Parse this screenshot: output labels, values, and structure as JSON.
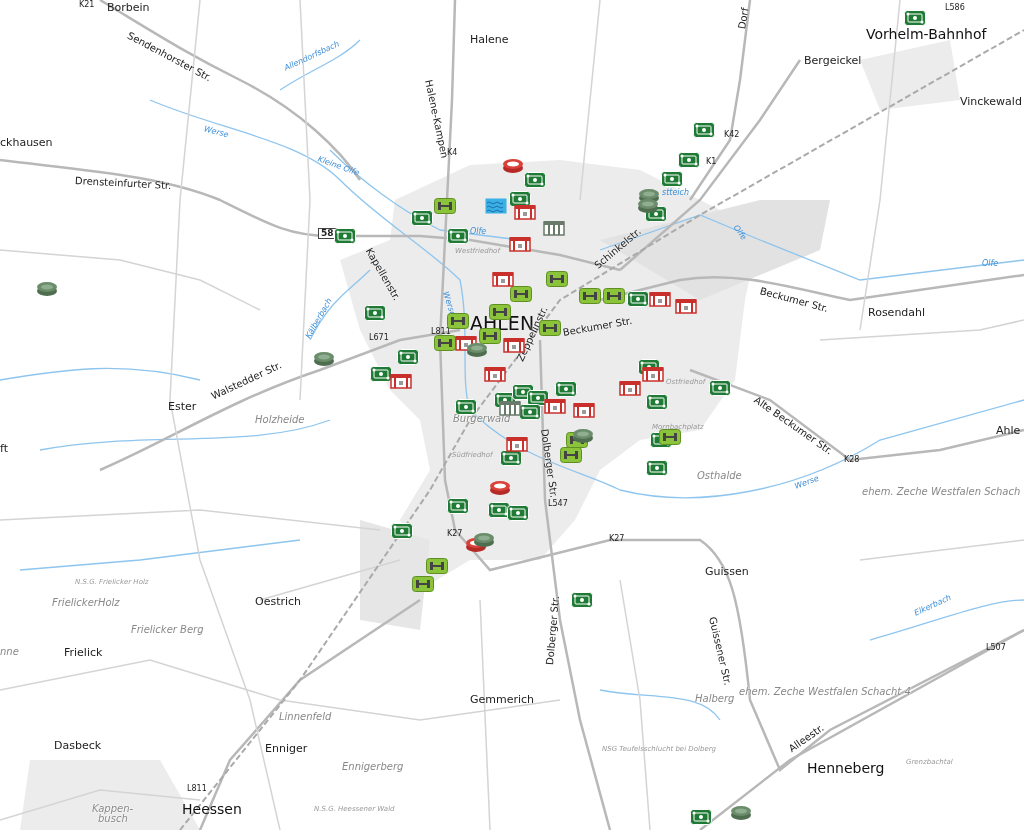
{
  "map": {
    "labels": [
      {
        "text": "K21",
        "kind": "road"
      },
      {
        "text": "Borbein",
        "kind": "place"
      },
      {
        "text": "Sendenhorster Str.",
        "kind": "street"
      },
      {
        "text": "Halene",
        "kind": "place"
      },
      {
        "text": "Halene-Kampen",
        "kind": "street"
      },
      {
        "text": "Dorf",
        "kind": "street"
      },
      {
        "text": "L586",
        "kind": "road"
      },
      {
        "text": "Vorhelm-Bahnhof",
        "kind": "town"
      },
      {
        "text": "Bergeickel",
        "kind": "place"
      },
      {
        "text": "Allendorfsbach",
        "kind": "water"
      },
      {
        "text": "Vinckewald",
        "kind": "place"
      },
      {
        "text": "Werse",
        "kind": "water"
      },
      {
        "text": "ckhausen",
        "kind": "place"
      },
      {
        "text": "K42",
        "kind": "road"
      },
      {
        "text": "Kleine Olfe",
        "kind": "water"
      },
      {
        "text": "K4",
        "kind": "road"
      },
      {
        "text": "K1",
        "kind": "road"
      },
      {
        "text": "Drensteinfurter Str.",
        "kind": "street"
      },
      {
        "text": "stteich",
        "kind": "water"
      },
      {
        "text": "Olfe",
        "kind": "water"
      },
      {
        "text": "58",
        "kind": "shield"
      },
      {
        "text": "Kapellenstr.",
        "kind": "street"
      },
      {
        "text": "Schinkelstr.",
        "kind": "street"
      },
      {
        "text": "Westfriedhof",
        "kind": "small"
      },
      {
        "text": "Olfe",
        "kind": "water"
      },
      {
        "text": "Olfe",
        "kind": "water"
      },
      {
        "text": "Beckumer Str.",
        "kind": "street"
      },
      {
        "text": "Werse",
        "kind": "water"
      },
      {
        "text": "Rosendahl",
        "kind": "place"
      },
      {
        "text": "AHLEN",
        "kind": "city"
      },
      {
        "text": "Beckumer Str.",
        "kind": "street"
      },
      {
        "text": "L811",
        "kind": "road"
      },
      {
        "text": "L671",
        "kind": "road"
      },
      {
        "text": "Kälberbach",
        "kind": "water"
      },
      {
        "text": "Zeppelinstr.",
        "kind": "street"
      },
      {
        "text": "Ostfriedhof",
        "kind": "small"
      },
      {
        "text": "Alte Beckumer Str.",
        "kind": "street"
      },
      {
        "text": "Walstedder Str.",
        "kind": "street"
      },
      {
        "text": "Ester",
        "kind": "place"
      },
      {
        "text": "Holzheide",
        "kind": "area"
      },
      {
        "text": "Burgerwald",
        "kind": "area"
      },
      {
        "text": "Dolberger Str.",
        "kind": "street"
      },
      {
        "text": "Mornbachplatz",
        "kind": "small"
      },
      {
        "text": "Ahle",
        "kind": "place"
      },
      {
        "text": "ft",
        "kind": "place"
      },
      {
        "text": "Südfriedhof",
        "kind": "small"
      },
      {
        "text": "K28",
        "kind": "road"
      },
      {
        "text": "Osthalde",
        "kind": "area"
      },
      {
        "text": "Werse",
        "kind": "water"
      },
      {
        "text": "ehem. Zeche Westfalen Schach",
        "kind": "area"
      },
      {
        "text": "L547",
        "kind": "road"
      },
      {
        "text": "K27",
        "kind": "road"
      },
      {
        "text": "K27",
        "kind": "road"
      },
      {
        "text": "Guissen",
        "kind": "place"
      },
      {
        "text": "N.S.G. Frielicker Holz",
        "kind": "small"
      },
      {
        "text": "Oestrich",
        "kind": "place"
      },
      {
        "text": "FrielickerHolz",
        "kind": "area"
      },
      {
        "text": "Elkerbach",
        "kind": "water"
      },
      {
        "text": "Guissener Str.",
        "kind": "street"
      },
      {
        "text": "Frielicker Berg",
        "kind": "area"
      },
      {
        "text": "L507",
        "kind": "road"
      },
      {
        "text": "nne",
        "kind": "area"
      },
      {
        "text": "Frielick",
        "kind": "place"
      },
      {
        "text": "Dolberger Str.",
        "kind": "street"
      },
      {
        "text": "Halberg",
        "kind": "area"
      },
      {
        "text": "ehem. Zeche Westfalen Schacht 4",
        "kind": "area"
      },
      {
        "text": "Gemmerich",
        "kind": "place"
      },
      {
        "text": "Linnenfeld",
        "kind": "area"
      },
      {
        "text": "Dasbeck",
        "kind": "place"
      },
      {
        "text": "Enniger",
        "kind": "place"
      },
      {
        "text": "NSG Teufelsschlucht bei Dolberg",
        "kind": "small"
      },
      {
        "text": "Alleestr.",
        "kind": "street"
      },
      {
        "text": "Ennigerberg",
        "kind": "area"
      },
      {
        "text": "Henneberg",
        "kind": "town"
      },
      {
        "text": "Grenzbachtal",
        "kind": "small"
      },
      {
        "text": "L811",
        "kind": "road"
      },
      {
        "text": "Kappen-",
        "kind": "area"
      },
      {
        "text": "busch",
        "kind": "area"
      },
      {
        "text": "Heessen",
        "kind": "town"
      },
      {
        "text": "N.S.G. Heessener Wald",
        "kind": "small"
      }
    ],
    "markers": [
      {
        "kind": "playground"
      },
      {
        "kind": "playground"
      },
      {
        "kind": "playground"
      },
      {
        "kind": "playground"
      },
      {
        "kind": "playground"
      },
      {
        "kind": "playground"
      },
      {
        "kind": "playground"
      },
      {
        "kind": "playground"
      },
      {
        "kind": "playground"
      },
      {
        "kind": "playground"
      },
      {
        "kind": "playground"
      },
      {
        "kind": "playground"
      },
      {
        "kind": "playground"
      },
      {
        "kind": "playground"
      },
      {
        "kind": "playground"
      },
      {
        "kind": "playground"
      },
      {
        "kind": "playground"
      },
      {
        "kind": "playground"
      },
      {
        "kind": "playground"
      },
      {
        "kind": "playground"
      },
      {
        "kind": "playground"
      },
      {
        "kind": "playground"
      },
      {
        "kind": "playground"
      },
      {
        "kind": "playground"
      },
      {
        "kind": "playground"
      },
      {
        "kind": "playground"
      },
      {
        "kind": "playground"
      },
      {
        "kind": "playground"
      },
      {
        "kind": "playground"
      },
      {
        "kind": "playground"
      },
      {
        "kind": "playground"
      },
      {
        "kind": "playground"
      },
      {
        "kind": "gym"
      },
      {
        "kind": "gym"
      },
      {
        "kind": "gym"
      },
      {
        "kind": "gym"
      },
      {
        "kind": "gym"
      },
      {
        "kind": "gym"
      },
      {
        "kind": "gym"
      },
      {
        "kind": "gym"
      },
      {
        "kind": "gym"
      },
      {
        "kind": "gym"
      },
      {
        "kind": "gym"
      },
      {
        "kind": "gym"
      },
      {
        "kind": "gym"
      },
      {
        "kind": "gym"
      },
      {
        "kind": "gym"
      },
      {
        "kind": "hall"
      },
      {
        "kind": "hall"
      },
      {
        "kind": "hall"
      },
      {
        "kind": "hall"
      },
      {
        "kind": "hall"
      },
      {
        "kind": "hall"
      },
      {
        "kind": "hall"
      },
      {
        "kind": "hall"
      },
      {
        "kind": "hall"
      },
      {
        "kind": "hall"
      },
      {
        "kind": "hall"
      },
      {
        "kind": "hall"
      },
      {
        "kind": "hall"
      },
      {
        "kind": "hall"
      },
      {
        "kind": "stadium"
      },
      {
        "kind": "stadium"
      },
      {
        "kind": "stadium"
      },
      {
        "kind": "arena"
      },
      {
        "kind": "arena"
      },
      {
        "kind": "arena"
      },
      {
        "kind": "arena"
      },
      {
        "kind": "arena"
      },
      {
        "kind": "arena"
      },
      {
        "kind": "arena"
      },
      {
        "kind": "arena"
      },
      {
        "kind": "pool"
      },
      {
        "kind": "shed"
      },
      {
        "kind": "shed"
      }
    ]
  }
}
